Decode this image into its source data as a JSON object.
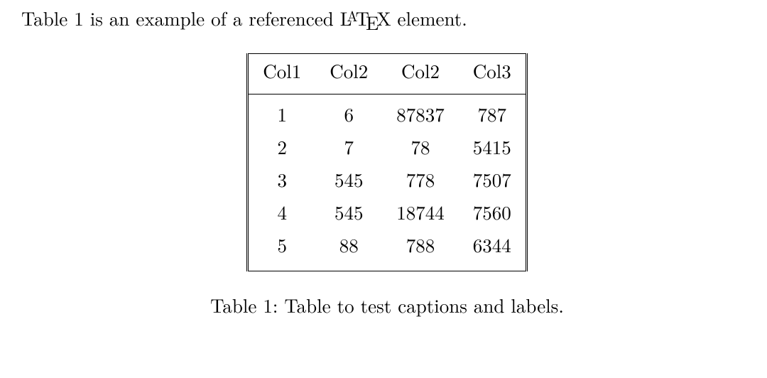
{
  "intro": {
    "before": "Table 1 is an example of a referenced ",
    "after": " element."
  },
  "latex": {
    "L": "L",
    "A": "A",
    "T": "T",
    "E": "E",
    "X": "X"
  },
  "chart_data": {
    "type": "table",
    "headers": [
      "Col1",
      "Col2",
      "Col2",
      "Col3"
    ],
    "rows": [
      [
        "1",
        "6",
        "87837",
        "787"
      ],
      [
        "2",
        "7",
        "78",
        "5415"
      ],
      [
        "3",
        "545",
        "778",
        "7507"
      ],
      [
        "4",
        "545",
        "18744",
        "7560"
      ],
      [
        "5",
        "88",
        "788",
        "6344"
      ]
    ]
  },
  "caption": "Table 1: Table to test captions and labels."
}
